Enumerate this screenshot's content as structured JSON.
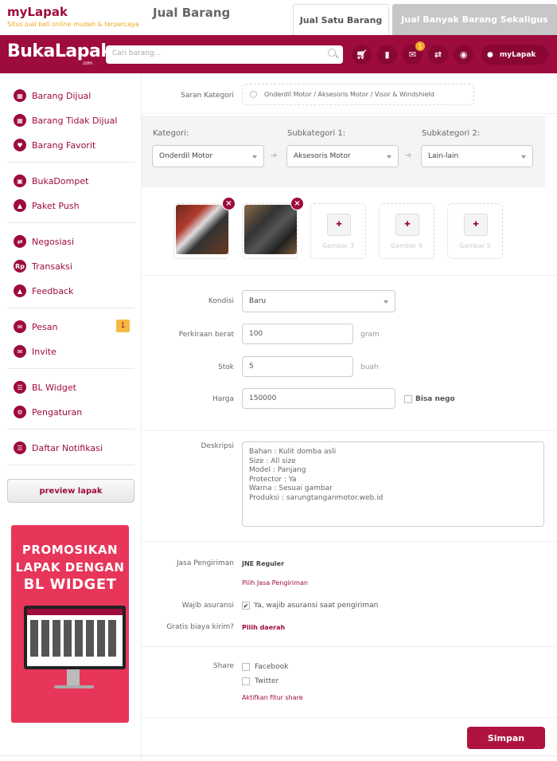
{
  "brand": {
    "name": "myLapak",
    "tagline": "Situs jual beli online mudah & terpercaya"
  },
  "page_title": "Jual Barang",
  "top_tabs": [
    {
      "label": "Jual Satu Barang",
      "active": true
    },
    {
      "label": "Jual Banyak Barang Sekaligus",
      "active": false
    }
  ],
  "header": {
    "logo": "BukaLapak",
    "logo_suffix": ".com",
    "search_placeholder": "Cari barang...",
    "badge_count": "1",
    "user_label": "myLapak",
    "icons": [
      "cart-icon",
      "bookmark-icon",
      "mail-icon",
      "transfer-icon",
      "camera-icon",
      "user-icon"
    ]
  },
  "sidebar": {
    "items": [
      {
        "label": "Barang Dijual",
        "icon": "box-icon"
      },
      {
        "label": "Barang Tidak Dijual",
        "icon": "box-off-icon"
      },
      {
        "label": "Barang Favorit",
        "icon": "heart-icon"
      },
      {
        "label": "BukaDompet",
        "icon": "wallet-icon"
      },
      {
        "label": "Paket Push",
        "icon": "push-icon"
      },
      {
        "label": "Negosiasi",
        "icon": "negotiate-icon"
      },
      {
        "label": "Transaksi",
        "icon": "rp-icon",
        "glyph": "Rp"
      },
      {
        "label": "Feedback",
        "icon": "thumb-icon"
      },
      {
        "label": "Pesan",
        "icon": "mail-icon",
        "badge": "1"
      },
      {
        "label": "Invite",
        "icon": "invite-icon"
      },
      {
        "label": "BL Widget",
        "icon": "widget-icon"
      },
      {
        "label": "Pengaturan",
        "icon": "gear-icon"
      },
      {
        "label": "Daftar Notifikasi",
        "icon": "list-icon"
      }
    ],
    "preview_button": "preview lapak",
    "promo": {
      "lines": [
        "PROMOSIKAN",
        "LAPAK DENGAN",
        "BL WIDGET"
      ]
    }
  },
  "form": {
    "saran_kategori_label": "Saran Kategori",
    "saran_kategori_value": "Onderdil Motor / Aksesoris Motor / Visor & Windshield",
    "kategori_label": "Kategori:",
    "kategori_value": "Onderdil Motor",
    "subkategori1_label": "Subkategori 1:",
    "subkategori1_value": "Aksesoris Motor",
    "subkategori2_label": "Subkategori 2:",
    "subkategori2_value": "Lain-lain",
    "image_slots": [
      "Gambar 3",
      "Gambar 4",
      "Gambar 5"
    ],
    "kondisi_label": "Kondisi",
    "kondisi_value": "Baru",
    "berat_label": "Perkiraan berat",
    "berat_value": "100",
    "berat_unit": "gram",
    "stok_label": "Stok",
    "stok_value": "5",
    "stok_unit": "buah",
    "harga_label": "Harga",
    "harga_value": "150000",
    "nego_label": "Bisa nego",
    "deskripsi_label": "Deskripsi",
    "deskripsi_lines": [
      "Bahan : Kulit domba asli",
      "Size : All size",
      "Model : Panjang",
      "Protector : Ya",
      "Warna : Sesuai gambar",
      "Produksi : sarungtanganmotor.web.id"
    ],
    "jasa_label": "Jasa Pengiriman",
    "jasa_value": "JNE Reguler",
    "jasa_link": "Pilih Jasa Pengiriman",
    "asuransi_label": "Wajib asuransi",
    "asuransi_text": "Ya, wajib asuransi saat pengiriman",
    "gratis_label": "Gratis biaya kirim?",
    "gratis_link": "Pilih daerah",
    "share_label": "Share",
    "share_options": [
      "Facebook",
      "Twitter"
    ],
    "share_link": "Aktifkan fitur share",
    "save_button": "Simpan"
  },
  "colors": {
    "brand": "#9e0b3d",
    "accent": "#f5a623",
    "save": "#b0133f"
  }
}
